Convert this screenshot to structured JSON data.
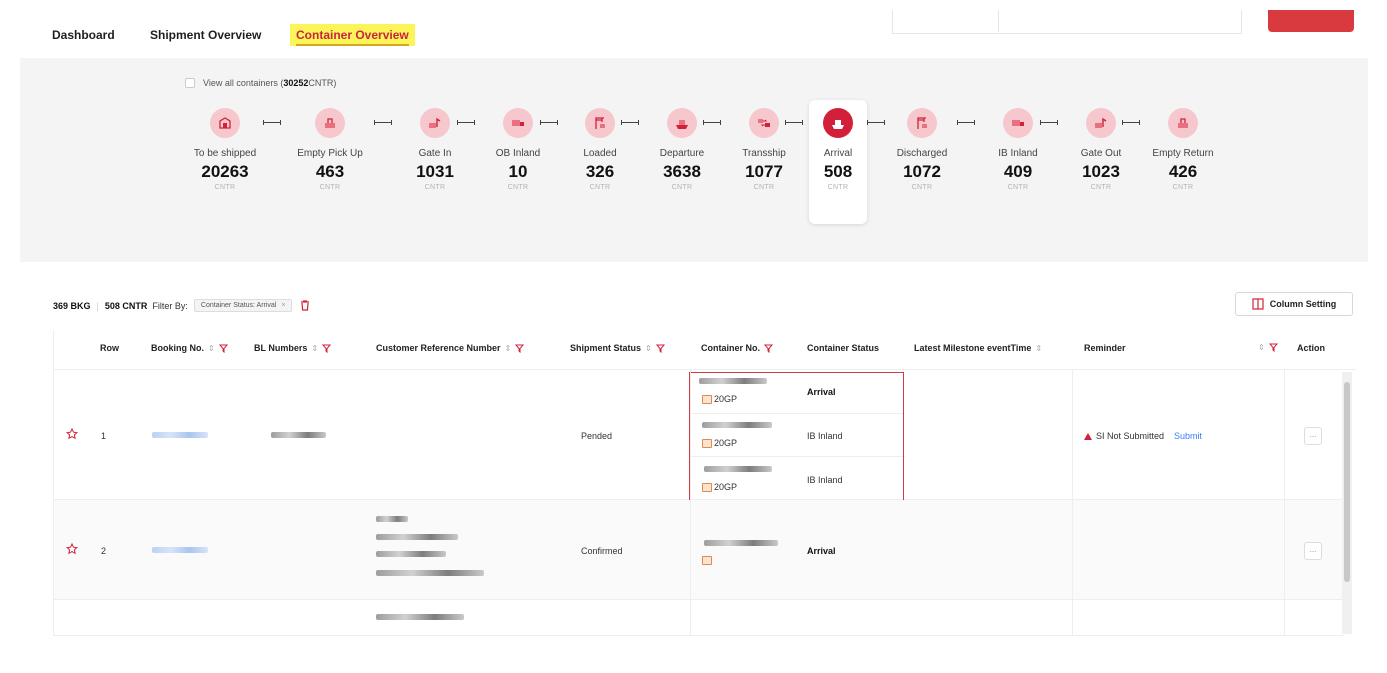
{
  "nav": {
    "items": [
      {
        "label": "Dashboard"
      },
      {
        "label": "Shipment Overview"
      },
      {
        "label": "Container Overview"
      }
    ]
  },
  "panel": {
    "view_all_prefix": "View all containers (",
    "view_all_count": "30252",
    "view_all_suffix": " CNTR)",
    "steps": [
      {
        "label": "To be shipped",
        "count": "20263",
        "unit": "CNTR"
      },
      {
        "label": "Empty Pick Up",
        "count": "463",
        "unit": "CNTR"
      },
      {
        "label": "Gate In",
        "count": "1031",
        "unit": "CNTR"
      },
      {
        "label": "OB Inland",
        "count": "10",
        "unit": "CNTR"
      },
      {
        "label": "Loaded",
        "count": "326",
        "unit": "CNTR"
      },
      {
        "label": "Departure",
        "count": "3638",
        "unit": "CNTR"
      },
      {
        "label": "Transship",
        "count": "1077",
        "unit": "CNTR"
      },
      {
        "label": "Arrival",
        "count": "508",
        "unit": "CNTR"
      },
      {
        "label": "Discharged",
        "count": "1072",
        "unit": "CNTR"
      },
      {
        "label": "IB Inland",
        "count": "409",
        "unit": "CNTR"
      },
      {
        "label": "Gate Out",
        "count": "1023",
        "unit": "CNTR"
      },
      {
        "label": "Empty Return",
        "count": "426",
        "unit": "CNTR"
      }
    ]
  },
  "summary": {
    "bkg": "369 BKG",
    "cntr": "508 CNTR",
    "filter_label": "Filter By:",
    "filter_chip": "Container Status: Arrival",
    "chip_close": "×",
    "column_setting": "Column Setting"
  },
  "table": {
    "headers": {
      "row": "Row",
      "booking": "Booking No.",
      "bl": "BL Numbers",
      "custref": "Customer Reference Number",
      "shipstatus": "Shipment Status",
      "container": "Container No.",
      "cstatus": "Container Status",
      "milestone": "Latest Milestone eventTime",
      "reminder": "Reminder",
      "action": "Action"
    },
    "sort_glyph": "⇕",
    "rows": [
      {
        "row": "1",
        "shipment_status": "Pended",
        "containers": [
          {
            "type": "20GP",
            "status": "Arrival"
          },
          {
            "type": "20GP",
            "status": "IB Inland"
          },
          {
            "type": "20GP",
            "status": "IB Inland"
          }
        ],
        "reminder": "SI Not Submitted",
        "reminder_action": "Submit",
        "action": "..."
      },
      {
        "row": "2",
        "shipment_status": "Confirmed",
        "containers": [
          {
            "type": "",
            "status": "Arrival"
          }
        ],
        "action": "..."
      }
    ]
  },
  "colors": {
    "accent": "#d3203a",
    "highlight": "#fbf55a",
    "panel_bg": "#f4f4f5"
  }
}
